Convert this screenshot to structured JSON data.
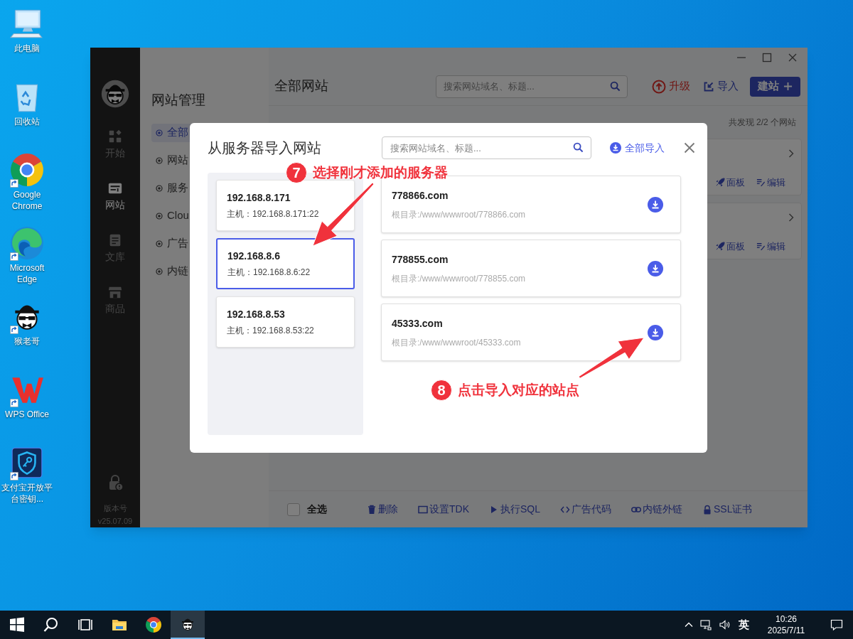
{
  "desktop": {
    "icons": [
      {
        "kind": "computer",
        "label": "此电脑",
        "shortcut": false
      },
      {
        "kind": "recycle-bin",
        "label": "回收站",
        "shortcut": false
      },
      {
        "kind": "chrome",
        "label": "Google Chrome",
        "shortcut": true
      },
      {
        "kind": "edge",
        "label": "Microsoft Edge",
        "shortcut": true
      },
      {
        "kind": "monkey",
        "label": "猴老哥",
        "shortcut": true
      },
      {
        "kind": "wps",
        "label": "WPS Office",
        "shortcut": true
      },
      {
        "kind": "key-shield",
        "label": "支付宝开放平台密钥...",
        "shortcut": true
      }
    ]
  },
  "app": {
    "nav": [
      {
        "kind": "start",
        "label": "开始",
        "selected": false
      },
      {
        "kind": "sites",
        "label": "网站",
        "selected": true
      },
      {
        "kind": "library",
        "label": "文库",
        "selected": false
      },
      {
        "kind": "shop",
        "label": "商品",
        "selected": false
      }
    ],
    "version_label": "版本号",
    "version": "v25.07.09",
    "sidebar": {
      "title": "网站管理",
      "items": [
        {
          "label": "全部",
          "selected": true
        },
        {
          "label": "网站",
          "selected": false
        },
        {
          "label": "服务",
          "selected": false
        },
        {
          "label": "Clou",
          "selected": false
        },
        {
          "label": "广告",
          "selected": false
        },
        {
          "label": "内链",
          "selected": false
        }
      ]
    },
    "header": {
      "title": "全部网站",
      "search_placeholder": "搜索网站域名、标题...",
      "actions": [
        {
          "kind": "upgrade",
          "label": "升级"
        },
        {
          "kind": "import",
          "label": "导入"
        },
        {
          "kind": "create",
          "label": "建站"
        }
      ]
    },
    "count": "共发现 2/2 个网站",
    "site_cards": [
      {
        "actions": [
          {
            "kind": "panel",
            "label": "面板"
          },
          {
            "kind": "edit",
            "label": "编辑"
          }
        ]
      },
      {
        "actions": [
          {
            "kind": "panel",
            "label": "面板"
          },
          {
            "kind": "edit",
            "label": "编辑"
          }
        ]
      }
    ],
    "footer": {
      "select_all": {
        "label": "全选",
        "checked": false
      },
      "actions": [
        {
          "kind": "delete",
          "label": "删除"
        },
        {
          "kind": "tdk",
          "label": "设置TDK"
        },
        {
          "kind": "sql",
          "label": "执行SQL"
        },
        {
          "kind": "code",
          "label": "广告代码"
        },
        {
          "kind": "link",
          "label": "内链外链"
        },
        {
          "kind": "ssl",
          "label": "SSL证书"
        }
      ]
    }
  },
  "dialog": {
    "title": "从服务器导入网站",
    "search_placeholder": "搜索网站域名、标题...",
    "import_all": "全部导入",
    "servers": [
      {
        "name": "192.168.8.171",
        "host": "主机：192.168.8.171:22",
        "selected": false
      },
      {
        "name": "192.168.8.6",
        "host": "主机：192.168.8.6:22",
        "selected": true
      },
      {
        "name": "192.168.8.53",
        "host": "主机：192.168.8.53:22",
        "selected": false
      }
    ],
    "sites": [
      {
        "domain": "778866.com",
        "root": "根目录:/www/wwwroot/778866.com"
      },
      {
        "domain": "778855.com",
        "root": "根目录:/www/wwwroot/778855.com"
      },
      {
        "domain": "45333.com",
        "root": "根目录:/www/wwwroot/45333.com"
      }
    ]
  },
  "annotations": [
    {
      "number": "7",
      "text": "选择刚才添加的服务器"
    },
    {
      "number": "8",
      "text": "点击导入对应的站点"
    }
  ],
  "taskbar": {
    "apps": [
      {
        "kind": "start",
        "active": false
      },
      {
        "kind": "search",
        "active": false
      },
      {
        "kind": "task-view",
        "active": false
      },
      {
        "kind": "file-explorer",
        "active": false
      },
      {
        "kind": "chrome",
        "active": false
      },
      {
        "kind": "monkey",
        "active": true
      }
    ],
    "tray": {
      "language": "英",
      "time": "10:26",
      "date": "2025/7/11"
    }
  }
}
